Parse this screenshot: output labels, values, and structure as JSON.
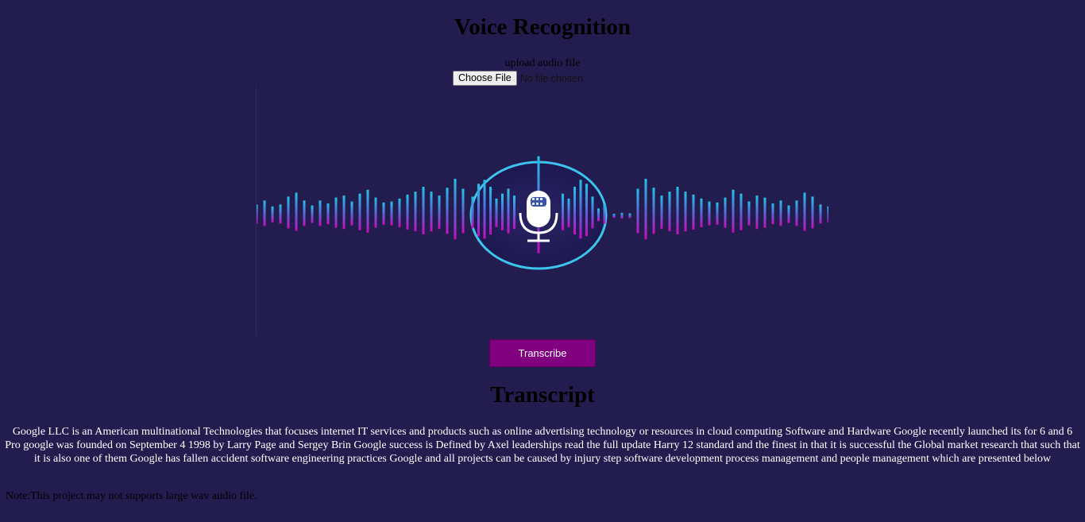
{
  "header": {
    "title": "Voice Recognition"
  },
  "upload": {
    "label": "upload audio file",
    "choose_button": "Choose File",
    "file_status": "No file chosen"
  },
  "visual": {
    "icon": "microphone-icon",
    "colors": {
      "ring": "#3cc4ec",
      "wave_top": "#23c3e6",
      "wave_bottom": "#c90bbf",
      "mic": "#ffffff"
    }
  },
  "actions": {
    "transcribe_button": "Transcribe"
  },
  "transcript": {
    "heading": "Transcript",
    "text": "Google LLC is an American multinational Technologies that focuses internet IT services and products such as online advertising technology or resources in cloud computing Software and Hardware Google recently launched its for 6 and 6 Pro google was founded on September 4 1998 by Larry Page and Sergey Brin Google success is Defined by Axel leaderships read the full update Harry 12 standard and the finest in that it is successful the Global market research that such that it is also one of them Google has fallen accident software engineering practices Google and all projects can be caused by injury step software development process management and people management which are presented below"
  },
  "footer": {
    "note": "Note:This project may not supports large wav audio file."
  },
  "theme": {
    "background": "#231d4f",
    "button": "#800080"
  }
}
